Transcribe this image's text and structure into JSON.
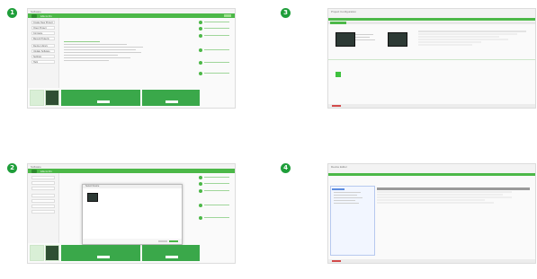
{
  "badges": [
    "1",
    "2",
    "3",
    "4"
  ],
  "panel1": {
    "window_title": "Software",
    "brand": "Life is On",
    "left_menu": [
      "Create New Project",
      "Open Project",
      "Compare",
      "Recent Projects",
      "Device Library",
      "Update Software",
      "Settings",
      "Help"
    ],
    "icon": "app-window-icon"
  },
  "panel2": {
    "window_title": "Software",
    "brand": "Life is On",
    "dialog_title": "Select Device",
    "icon": "dialog-icon"
  },
  "panel3": {
    "window_title": "Project Configuration",
    "icon": "device-icon"
  },
  "panel4": {
    "window_title": "Device Editor",
    "icon": "tree-icon"
  },
  "colors": {
    "accent": "#4cb848",
    "badge": "#1f9e3a",
    "alert": "#d24a4a"
  }
}
